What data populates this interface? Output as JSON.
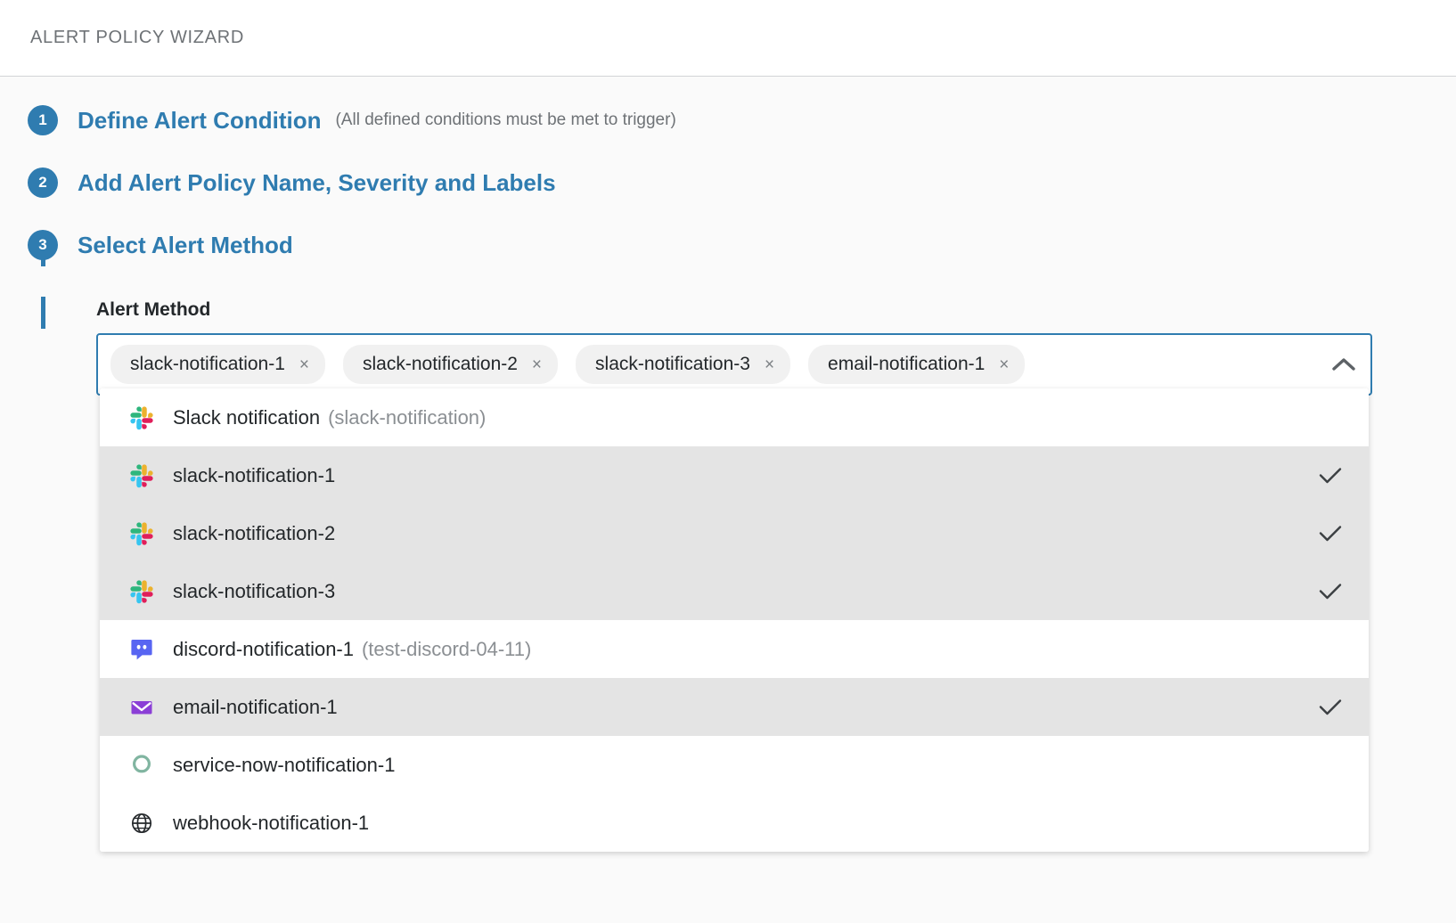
{
  "header": {
    "title": "ALERT POLICY WIZARD"
  },
  "wizard": {
    "steps": [
      {
        "number": "1",
        "label": "Define Alert Condition",
        "note": "(All defined conditions must be met to trigger)"
      },
      {
        "number": "2",
        "label": "Add Alert Policy Name, Severity and Labels",
        "note": ""
      },
      {
        "number": "3",
        "label": "Select Alert Method",
        "note": ""
      }
    ]
  },
  "alert_method": {
    "field_label": "Alert Method",
    "remove_glyph": "×",
    "toggle_icon": "chevron-up-icon",
    "chips": [
      {
        "label": "slack-notification-1"
      },
      {
        "label": "slack-notification-2"
      },
      {
        "label": "slack-notification-3"
      },
      {
        "label": "email-notification-1"
      }
    ],
    "options": [
      {
        "icon": "slack-icon",
        "label": "Slack notification",
        "sub": "(slack-notification)",
        "selected": false
      },
      {
        "icon": "slack-icon",
        "label": "slack-notification-1",
        "sub": "",
        "selected": true
      },
      {
        "icon": "slack-icon",
        "label": "slack-notification-2",
        "sub": "",
        "selected": true
      },
      {
        "icon": "slack-icon",
        "label": "slack-notification-3",
        "sub": "",
        "selected": true
      },
      {
        "icon": "discord-icon",
        "label": "discord-notification-1",
        "sub": "(test-discord-04-11)",
        "selected": false
      },
      {
        "icon": "email-icon",
        "label": "email-notification-1",
        "sub": "",
        "selected": true
      },
      {
        "icon": "service-now-icon",
        "label": "service-now-notification-1",
        "sub": "",
        "selected": false
      },
      {
        "icon": "webhook-icon",
        "label": "webhook-notification-1",
        "sub": "",
        "selected": false
      }
    ]
  },
  "colors": {
    "accent": "#2f7cb0",
    "selected_row": "#e4e4e4",
    "chip_bg": "#f1f1f1",
    "page_bg": "#fafafa",
    "discord": "#5865f2",
    "email": "#8b3fd6",
    "service_now": "#81b5a1"
  }
}
